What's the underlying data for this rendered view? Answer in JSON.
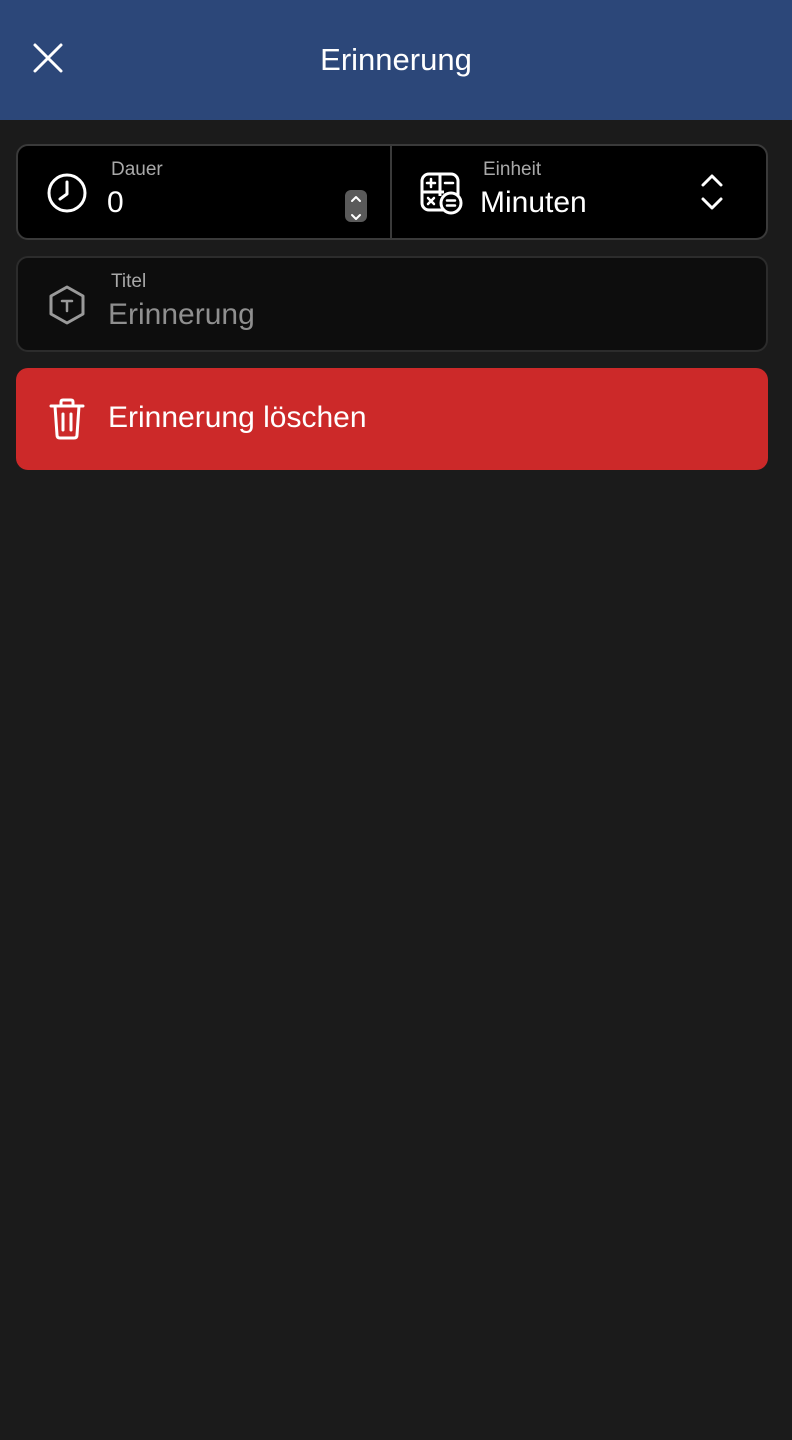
{
  "header": {
    "title": "Erinnerung",
    "close_icon": "close-icon",
    "background_color": "#2c4779"
  },
  "duration": {
    "label": "Dauer",
    "value": "0",
    "icon": "clock-icon"
  },
  "unit": {
    "label": "Einheit",
    "value": "Minuten",
    "icon": "calculator-icon",
    "chevron_icon": "chevron-up-down-icon"
  },
  "title_field": {
    "label": "Titel",
    "placeholder": "Erinnerung",
    "icon": "text-hexagon-icon"
  },
  "delete_button": {
    "label": "Erinnerung löschen",
    "icon": "trash-icon",
    "background_color": "#cc2929"
  }
}
